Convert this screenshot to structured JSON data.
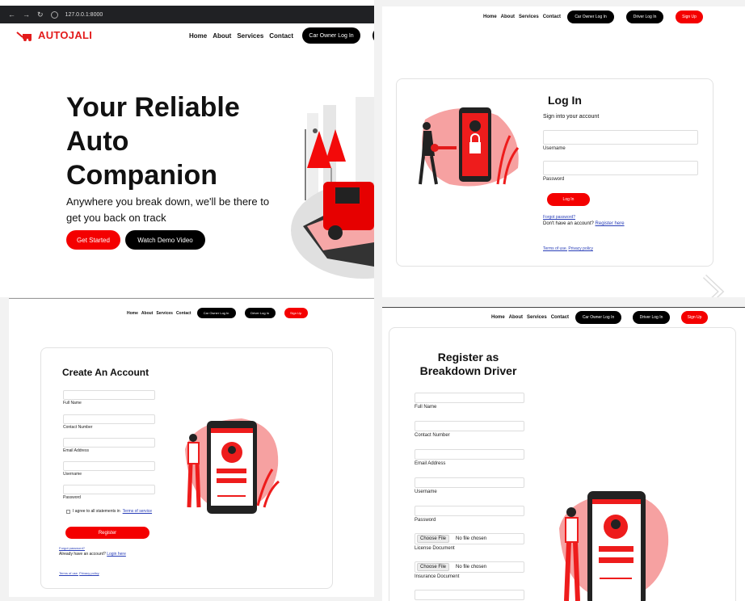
{
  "browser": {
    "url": "127.0.0.1:8000"
  },
  "brand": {
    "name": "AUTOJALI",
    "accent": "#f40000",
    "dark": "#000000"
  },
  "nav": {
    "home": "Home",
    "about": "About",
    "services": "Services",
    "contact": "Contact",
    "car_owner_login": "Car Owner Log In",
    "driver_login": "Driver Log In",
    "sign_up": "Sign Up"
  },
  "hero": {
    "title_line1": "Your Reliable",
    "title_line2": "Auto",
    "title_line3": "Companion",
    "subtitle_line1": "Anywhere you break down, we'll be there to",
    "subtitle_line2": "get you back on track",
    "get_started": "Get Started",
    "watch_demo": "Watch Demo Video"
  },
  "login": {
    "title": "Log In",
    "subtitle": "Sign into your account",
    "username_label": "Username",
    "password_label": "Password",
    "button": "Log In",
    "forgot": "Forgot password?",
    "no_account": "Don't have an account?",
    "register": "Register here",
    "terms": "Terms of use.",
    "privacy": "Privacy policy"
  },
  "create": {
    "title": "Create An Account",
    "full_name": "Full Name",
    "contact": "Contact Number",
    "email": "Email Address",
    "username": "Username",
    "password": "Password",
    "agree": "I agree to all statements in",
    "terms_link": "Terms of service",
    "button": "Register",
    "forgot": "Forgot password?",
    "have_account": "Already have an account?",
    "login_here": "Login here",
    "terms": "Terms of use.",
    "privacy": "Privacy policy"
  },
  "driver": {
    "title_line1": "Register as",
    "title_line2": "Breakdown Driver",
    "full_name": "Full Name",
    "contact": "Contact Number",
    "email": "Email Address",
    "username": "Username",
    "password": "Password",
    "choose_file": "Choose File",
    "no_file": "No file chosen",
    "license": "License Document",
    "insurance": "Insurance Document"
  }
}
